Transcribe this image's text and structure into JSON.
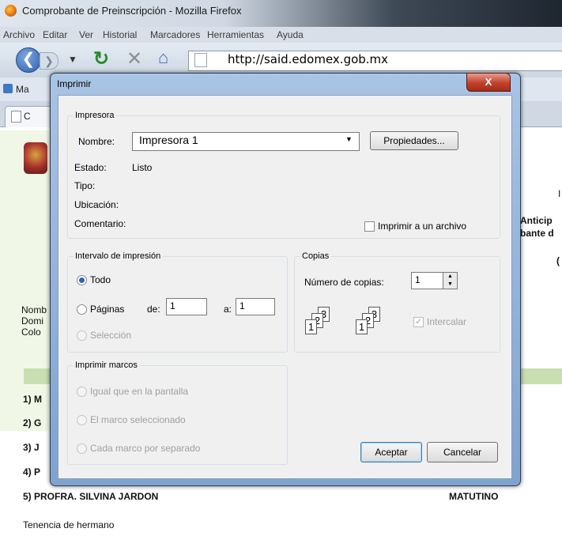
{
  "window": {
    "title": "Comprobante de Preinscripción - Mozilla Firefox"
  },
  "menu": [
    "Archivo",
    "Editar",
    "Ver",
    "Historial",
    "Marcadores",
    "Herramientas",
    "Ayuda"
  ],
  "nav": {
    "url": "http://said.edomex.gob.mx"
  },
  "bookmarks": {
    "first_label": "Ma"
  },
  "tab": {
    "label": "C"
  },
  "page": {
    "fragments_right": [
      "I",
      "Anticip",
      "bante d",
      "("
    ],
    "fragments_left": [
      "Nomb",
      "Domi",
      "Colo"
    ],
    "list_prefixes": [
      "1) M",
      "2) G",
      "3) J",
      "4) P"
    ],
    "row5_name": "5) PROFRA. SILVINA JARDON",
    "row5_shift": "MATUTINO",
    "footer": "Tenencia de hermano"
  },
  "dialog": {
    "title": "Imprimir",
    "close": "X",
    "printer": {
      "legend": "Impresora",
      "name_label": "Nombre:",
      "name_value": "Impresora 1",
      "properties_button": "Propiedades...",
      "status_label": "Estado:",
      "status_value": "Listo",
      "type_label": "Tipo:",
      "location_label": "Ubicación:",
      "comment_label": "Comentario:",
      "print_to_file": "Imprimir a un archivo"
    },
    "range": {
      "legend": "Intervalo de impresión",
      "all": "Todo",
      "pages": "Páginas",
      "from_label": "de:",
      "from_value": "1",
      "to_label": "a:",
      "to_value": "1",
      "selection": "Selección"
    },
    "copies": {
      "legend": "Copias",
      "count_label": "Número de copias:",
      "count_value": "1",
      "collate": "Intercalar",
      "digits": [
        "1",
        "2",
        "3"
      ]
    },
    "frames": {
      "legend": "Imprimir marcos",
      "as_screen": "Igual que en la pantalla",
      "selected": "El marco seleccionado",
      "each": "Cada marco por separado"
    },
    "ok": "Aceptar",
    "cancel": "Cancelar"
  }
}
